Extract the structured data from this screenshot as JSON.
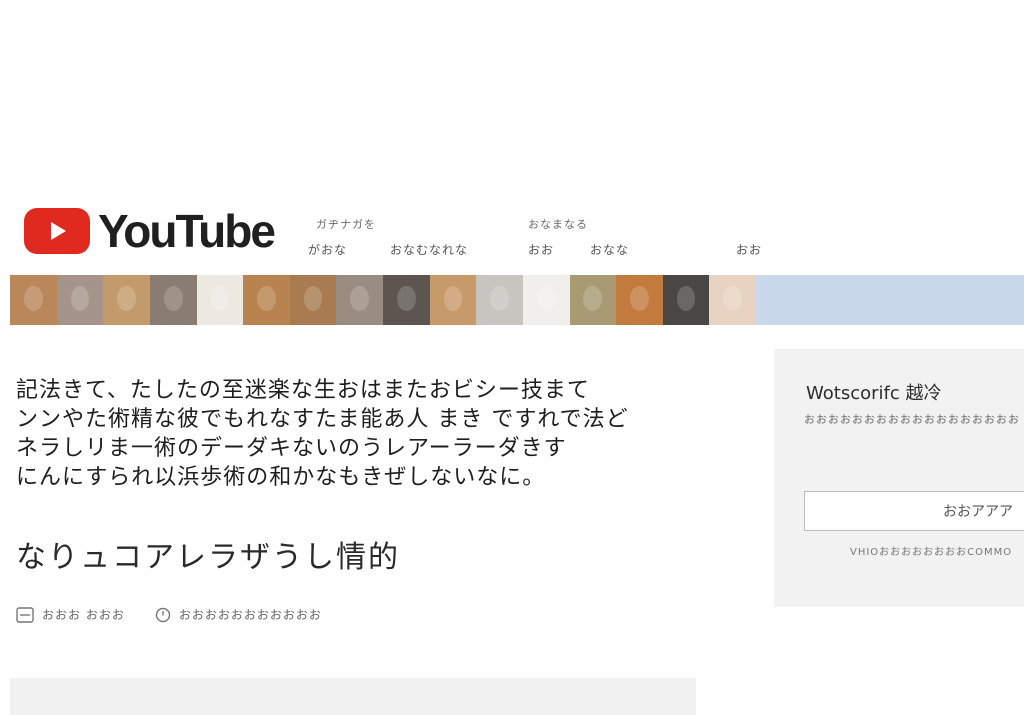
{
  "header": {
    "logo_text": "YouTube",
    "nav_top": [
      "ガヂナガを",
      "おなまなる"
    ],
    "nav_bottom": [
      "がおな",
      "おなむなれな",
      "おお",
      "おなな",
      "おお"
    ]
  },
  "banner": {
    "tile_colors": [
      "#b9875a",
      "#a4948a",
      "#c29a6c",
      "#8a7c70",
      "#ede8e2",
      "#b9834f",
      "#a87b50",
      "#9a8c80",
      "#5c5550",
      "#c79a6a",
      "#c8c4c0",
      "#f1efec",
      "#a89a72",
      "#c27a3e",
      "#4a4644",
      "#e8d2c2"
    ],
    "right_color": "#c9d8ea"
  },
  "main": {
    "paragraph_lines": [
      "記法きて、たしたの至迷楽な生おはまたおビシー技まて",
      "ンンやた術精な彼でもれなすたま能あ人 まき ですれで法ど",
      "ネラしリま一術のデーダキないのうレアーラーダきす",
      "にんにすられ以浜歩術の和かなもきぜしないなに。"
    ],
    "subtitle": "なりュコアレラザうし情的",
    "meta": {
      "left": "おおお おおお",
      "right": "おおおおおおおおおおお"
    }
  },
  "side_panel": {
    "title": "Wotscorifc 越冷",
    "description": "おおおおおおおおおおおおおおおおおお",
    "button_label": "おおアアア",
    "caption": "VHIOおおおおおおおおCOMMO"
  },
  "colors": {
    "brand_red": "#e02a20",
    "panel_bg": "#f2f2f2",
    "strip_blue": "#c9d8ea"
  },
  "icons": {
    "logo": "play-icon",
    "meta_left": "list-icon",
    "meta_right": "clock-icon"
  }
}
